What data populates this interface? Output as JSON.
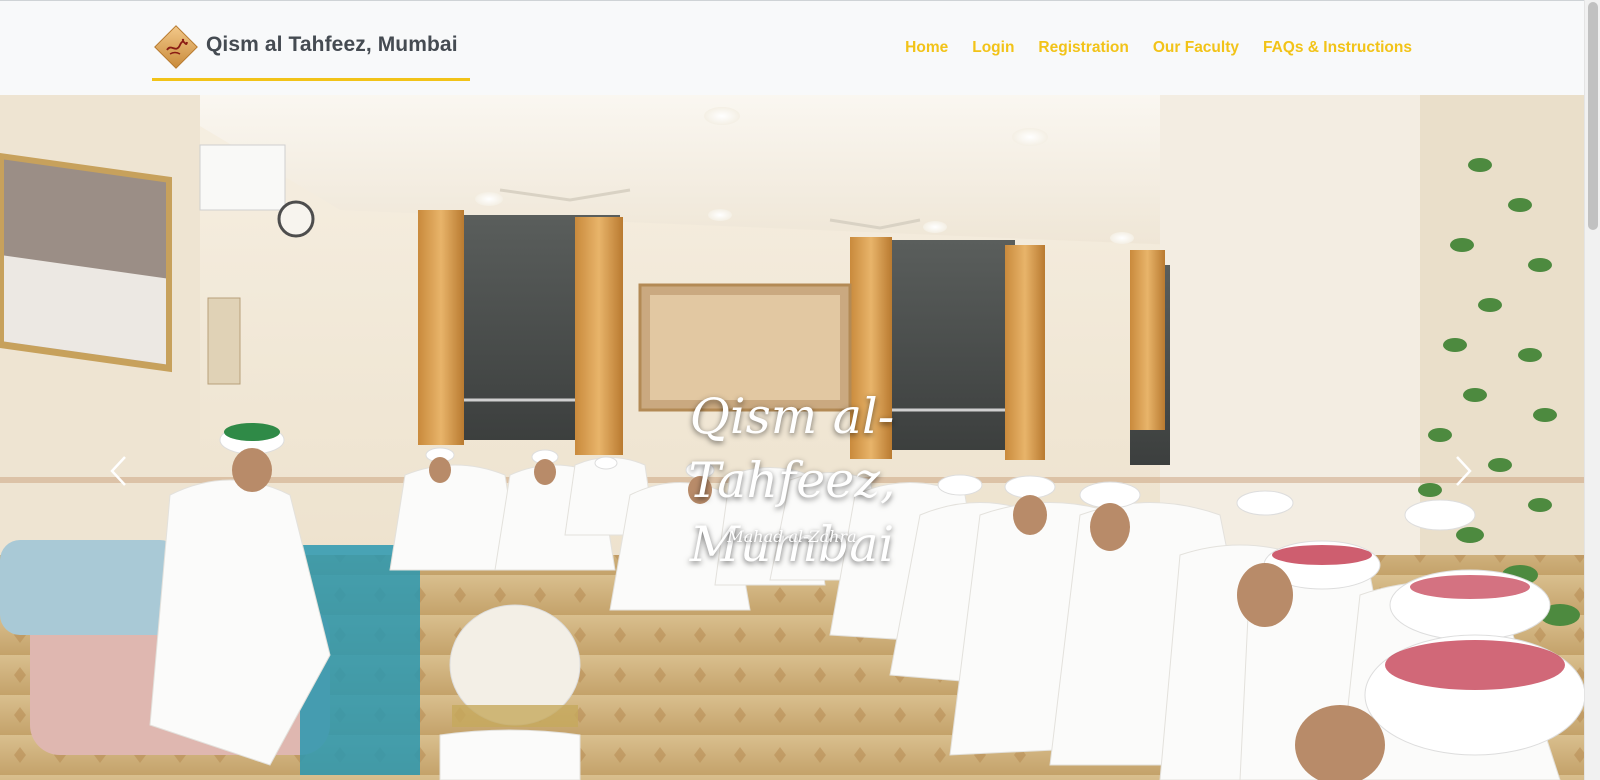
{
  "brand": {
    "title": "Qism al Tahfeez, Mumbai",
    "logo_icon": "calligraphy-logo-icon",
    "underline_color": "#f2c318"
  },
  "nav": {
    "items": [
      {
        "label": "Home"
      },
      {
        "label": "Login"
      },
      {
        "label": "Registration"
      },
      {
        "label": "Our Faculty"
      },
      {
        "label": "FAQs & Instructions"
      }
    ],
    "link_color": "#f2c318"
  },
  "hero": {
    "title": "Qism al-Tahfeez, Mumbai",
    "subtitle": "Mahad al-Zahra",
    "image": "hall-gathering-photo",
    "prev_icon": "chevron-left-icon",
    "next_icon": "chevron-right-icon"
  },
  "colors": {
    "accent": "#f2c318",
    "brand_text": "#454b52",
    "navbar_bg": "#f8f9fa"
  }
}
